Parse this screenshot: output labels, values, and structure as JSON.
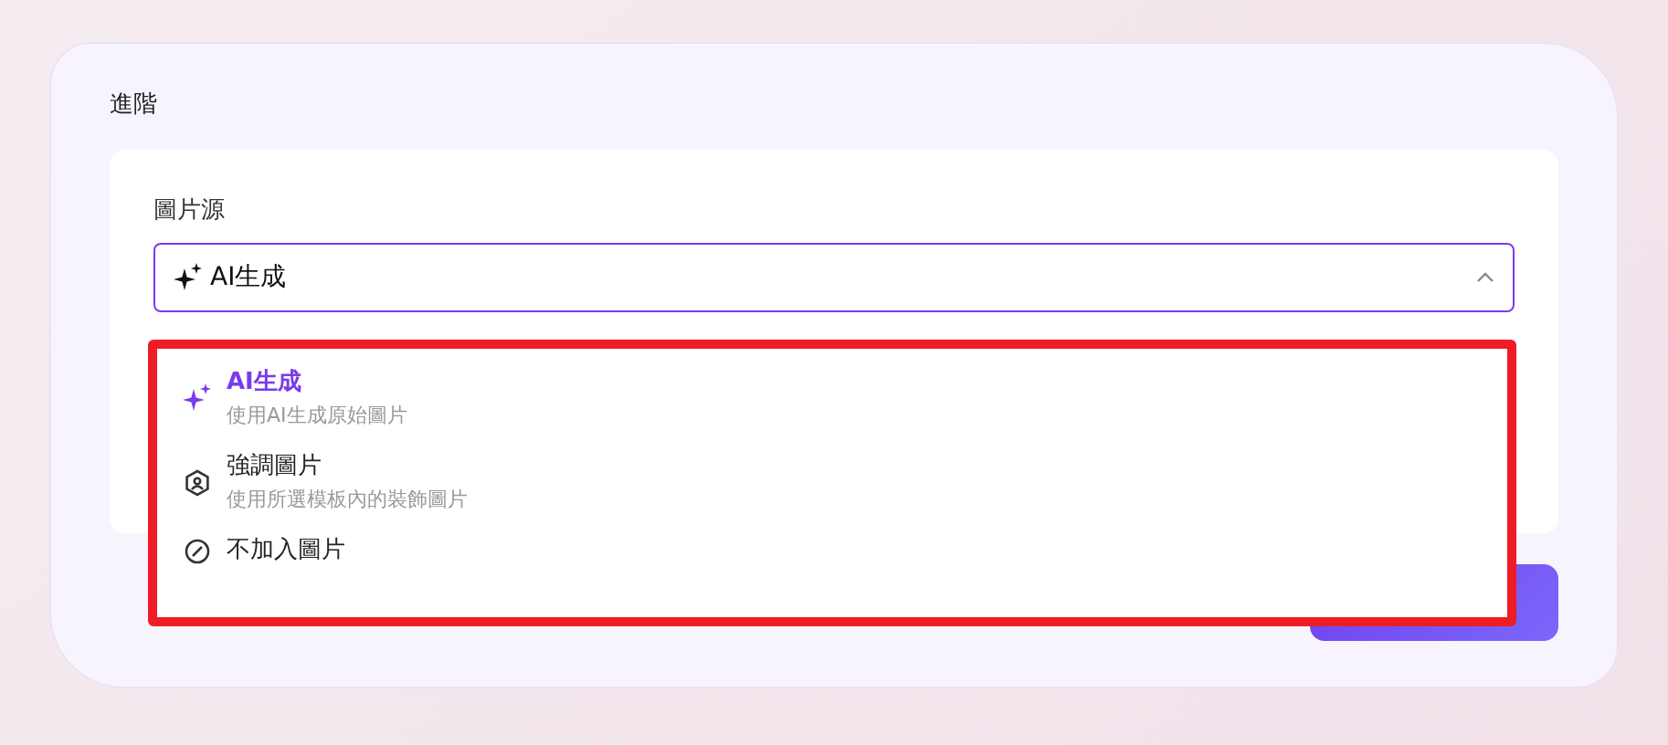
{
  "section": {
    "title": "進階"
  },
  "field": {
    "label": "圖片源",
    "value": "AI生成",
    "expanded": true
  },
  "options": [
    {
      "kind": "generate",
      "title": "AI生成",
      "description": "使用AI生成原始圖片",
      "selected": true
    },
    {
      "kind": "decoration",
      "title": "強調圖片",
      "description": "使用所選模板內的裝飾圖片",
      "selected": false
    },
    {
      "kind": "none",
      "title": "不加入圖片",
      "selected": false
    }
  ],
  "next_button": {
    "kind": "button"
  }
}
